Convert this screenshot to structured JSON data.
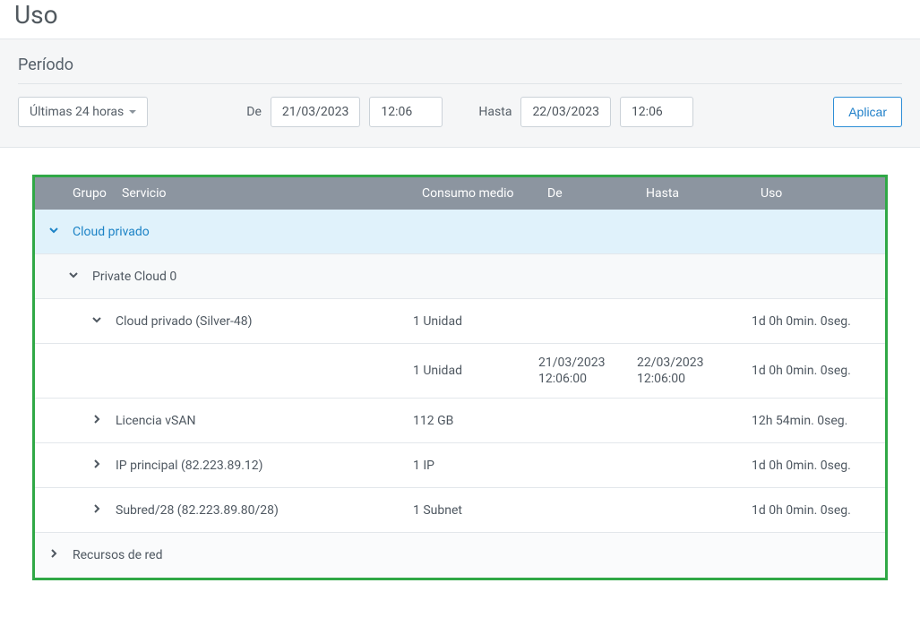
{
  "page": {
    "title": "Uso"
  },
  "period": {
    "title": "Período",
    "dropdown_label": "Últimas 24 horas",
    "de_label": "De",
    "de_date": "21/03/2023",
    "de_time": "12:06",
    "hasta_label": "Hasta",
    "hasta_date": "22/03/2023",
    "hasta_time": "12:06",
    "apply_label": "Aplicar"
  },
  "table": {
    "headers": {
      "grupo": "Grupo",
      "servicio": "Servicio",
      "consumo": "Consumo medio",
      "de": "De",
      "hasta": "Hasta",
      "uso": "Uso"
    },
    "rows": {
      "cloud_privado": {
        "label": "Cloud privado"
      },
      "private_cloud_0": {
        "label": "Private Cloud 0"
      },
      "silver48": {
        "label": "Cloud privado (Silver-48)",
        "consumo": "1 Unidad",
        "uso": "1d 0h 0min. 0seg."
      },
      "silver48_detail": {
        "consumo": "1 Unidad",
        "de": "21/03/2023 12:06:00",
        "hasta": "22/03/2023 12:06:00",
        "uso": "1d 0h 0min. 0seg."
      },
      "vsan": {
        "label": "Licencia vSAN",
        "consumo": "112 GB",
        "uso": "12h 54min. 0seg."
      },
      "ip_principal": {
        "label": "IP principal (82.223.89.12)",
        "consumo": "1 IP",
        "uso": "1d 0h 0min. 0seg."
      },
      "subred": {
        "label": "Subred/28 (82.223.89.80/28)",
        "consumo": "1 Subnet",
        "uso": "1d 0h 0min. 0seg."
      },
      "recursos_red": {
        "label": "Recursos de red"
      }
    }
  }
}
